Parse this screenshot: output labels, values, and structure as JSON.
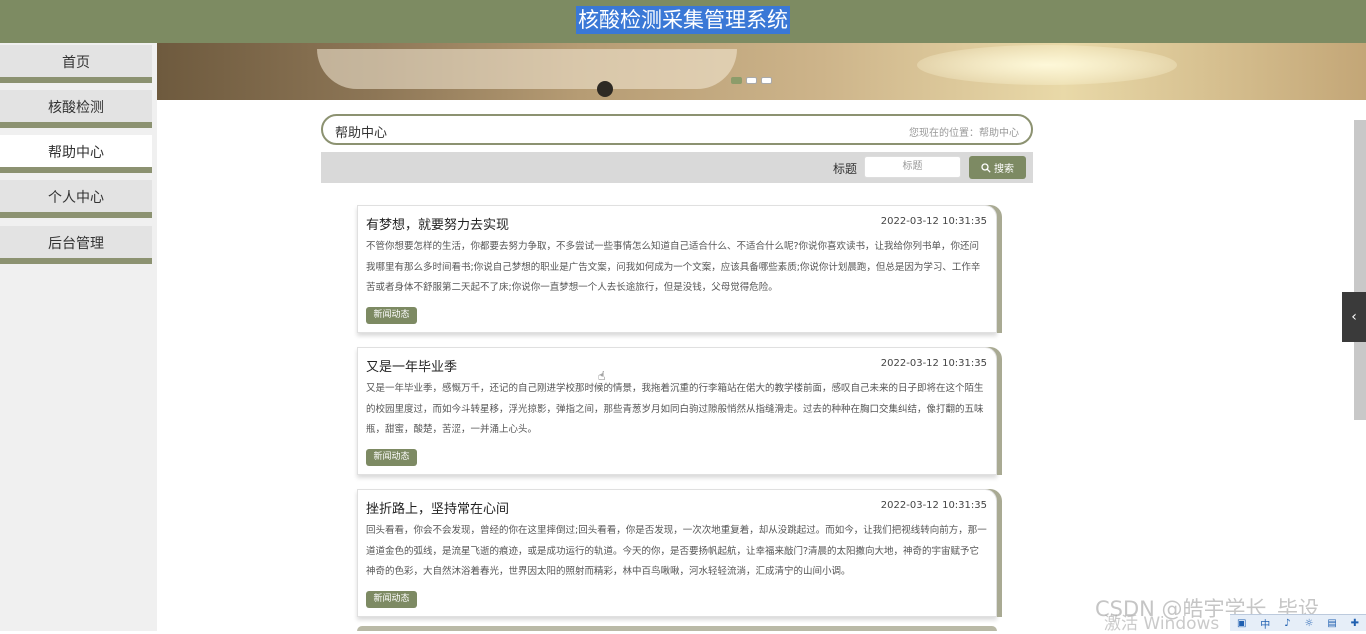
{
  "app": {
    "title": "核酸检测采集管理系统"
  },
  "sidebar": {
    "items": [
      {
        "label": "首页",
        "active": false
      },
      {
        "label": "核酸检测",
        "active": false
      },
      {
        "label": "帮助中心",
        "active": true
      },
      {
        "label": "个人中心",
        "active": false
      },
      {
        "label": "后台管理",
        "active": false
      }
    ]
  },
  "banner": {
    "carousel": {
      "slide_count": 3,
      "active_slide": 1
    }
  },
  "breadcrumb": {
    "section": "帮助中心",
    "location": "您现在的位置：帮助中心"
  },
  "search": {
    "label": "标题",
    "placeholder": "标题",
    "button_label": "搜索"
  },
  "articles": [
    {
      "title": "有梦想，就要努力去实现",
      "date": "2022-03-12 10:31:35",
      "body": "不管你想要怎样的生活，你都要去努力争取，不多尝试一些事情怎么知道自己适合什么、不适合什么呢?你说你喜欢读书，让我给你列书单，你还问我哪里有那么多时间看书;你说自己梦想的职业是广告文案，问我如何成为一个文案，应该具备哪些素质;你说你计划晨跑，但总是因为学习、工作辛苦或者身体不舒服第二天起不了床;你说你一直梦想一个人去长途旅行，但是没钱，父母觉得危险。",
      "tag": "新闻动态"
    },
    {
      "title": "又是一年毕业季",
      "date": "2022-03-12 10:31:35",
      "body": "又是一年毕业季，感慨万千，还记的自己刚进学校那时候的情景，我拖着沉重的行李箱站在偌大的教学楼前面，感叹自己未来的日子即将在这个陌生的校园里度过，而如今斗转星移，浮光掠影，弹指之间，那些青葱岁月如同白驹过隙般悄然从指缝滑走。过去的种种在胸口交集纠结，像打翻的五味瓶，甜蜜，酸楚，苦涩，一并涌上心头。",
      "tag": "新闻动态"
    },
    {
      "title": "挫折路上，坚持常在心间",
      "date": "2022-03-12 10:31:35",
      "body": "回头看看，你会不会发现，曾经的你在这里摔倒过;回头看看，你是否发现，一次次地重复着，却从没跳起过。而如今，让我们把视线转向前方，那一道道金色的弧线，是流星飞逝的痕迹，或是成功运行的轨道。今天的你，是否要扬帆起航，让幸福来敲门?清晨的太阳撒向大地，神奇的宇宙赋予它神奇的色彩，大自然沐浴着春光，世界因太阳的照射而精彩，林中百鸟啾啾，河水轻轻流淌，汇成清宁的山间小调。",
      "tag": "新闻动态"
    }
  ],
  "overlay": {
    "watermark_top": "CSDN @皓宇学长_毕设",
    "watermark_bottom": "激活 Windows"
  },
  "icons": {
    "search": "search-icon",
    "pager": "chevron-left-icon",
    "cursor": "hand-cursor-icon"
  },
  "colors": {
    "header_bg": "#7d8b62",
    "accent": "#7d8a63",
    "nav_border": "#8c9271",
    "title_highlight": "#3a78d6"
  }
}
